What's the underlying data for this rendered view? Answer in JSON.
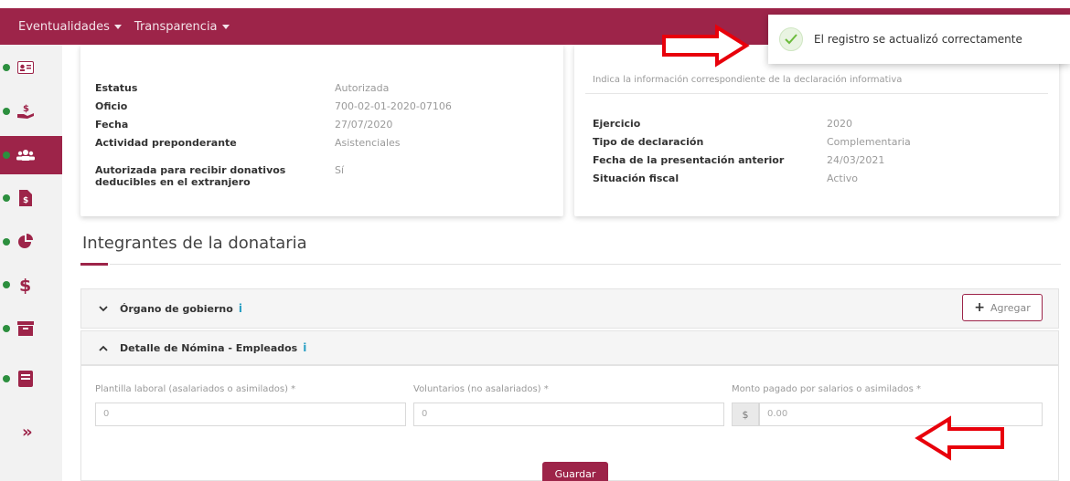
{
  "topnav": {
    "items": [
      {
        "label": "Eventualidades"
      },
      {
        "label": "Transparencia"
      }
    ]
  },
  "toast": {
    "message": "El registro se actualizó correctamente",
    "icon": "check-circle-icon",
    "accent": "#6cbb3c"
  },
  "colors": {
    "brand": "#9d2449",
    "status_dot": "#2c8f3e",
    "info": "#2ba0c4",
    "annotation_arrow": "#e8000b"
  },
  "sidebar": {
    "items": [
      {
        "icon": "id-card-icon"
      },
      {
        "icon": "donation-hand-icon"
      },
      {
        "icon": "users-group-icon",
        "active": true
      },
      {
        "icon": "document-dollar-icon"
      },
      {
        "icon": "pie-chart-icon"
      },
      {
        "icon": "dollar-sign-icon"
      },
      {
        "icon": "archive-box-icon"
      },
      {
        "icon": "book-icon"
      },
      {
        "icon": "double-chevron-right-icon"
      }
    ]
  },
  "left_card": {
    "rows": [
      {
        "key": "Estatus",
        "value": "Autorizada"
      },
      {
        "key": "Oficio",
        "value": "700-02-01-2020-07106"
      },
      {
        "key": "Fecha",
        "value": "27/07/2020"
      },
      {
        "key": "Actividad preponderante",
        "value": "Asistenciales"
      },
      {
        "key": "Autorizada para recibir donativos deducibles en el extranjero",
        "value": "Sí"
      }
    ]
  },
  "right_card": {
    "hint": "Indica la información correspondiente de la declaración informativa",
    "rows": [
      {
        "key": "Ejercicio",
        "value": "2020"
      },
      {
        "key": "Tipo de declaración",
        "value": "Complementaria"
      },
      {
        "key": "Fecha de la presentación anterior",
        "value": "24/03/2021"
      },
      {
        "key": "Situación fiscal",
        "value": "Activo"
      }
    ]
  },
  "section": {
    "title": "Integrantes de la donataria"
  },
  "accordions": [
    {
      "title": "Órgano de gobierno",
      "expanded": false
    },
    {
      "title": "Detalle de Nómina - Empleados",
      "expanded": true
    }
  ],
  "add_button": {
    "label": "Agregar"
  },
  "form": {
    "fields": [
      {
        "label": "Plantilla laboral (asalariados o asimilados) *",
        "value": "0"
      },
      {
        "label": "Voluntarios (no asalariados) *",
        "value": "0"
      },
      {
        "label": "Monto pagado por salarios o asimilados *",
        "prefix": "$",
        "value": "0.00"
      }
    ],
    "save_label": "Guardar"
  }
}
